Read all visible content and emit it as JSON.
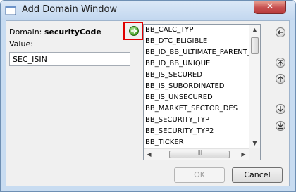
{
  "window": {
    "title": "Add Domain Window",
    "close_glyph": "✕"
  },
  "form": {
    "domain_label": "Domain:",
    "domain_value": "securityCode",
    "value_label": "Value:",
    "value_input": "SEC_ISIN"
  },
  "list": {
    "items": [
      "BB_CALC_TYP",
      "BB_DTC_ELIGIBLE",
      "BB_ID_BB_ULTIMATE_PARENT_CO",
      "BB_ID_BB_UNIQUE",
      "BB_IS_SECURED",
      "BB_IS_SUBORDINATED",
      "BB_IS_UNSECURED",
      "BB_MARKET_SECTOR_DES",
      "BB_SECURITY_TYP",
      "BB_SECURITY_TYP2",
      "BB_TICKER"
    ]
  },
  "buttons": {
    "ok": "OK",
    "cancel": "Cancel"
  },
  "icons": {
    "add": "arrow-right-icon",
    "remove": "arrow-left-icon",
    "move_top": "double-up-arrow-icon",
    "move_up": "up-arrow-icon",
    "move_down": "down-arrow-icon",
    "move_bottom": "double-down-arrow-icon"
  },
  "colors": {
    "highlight_border": "#e00000",
    "add_button": "#4aa52b"
  }
}
